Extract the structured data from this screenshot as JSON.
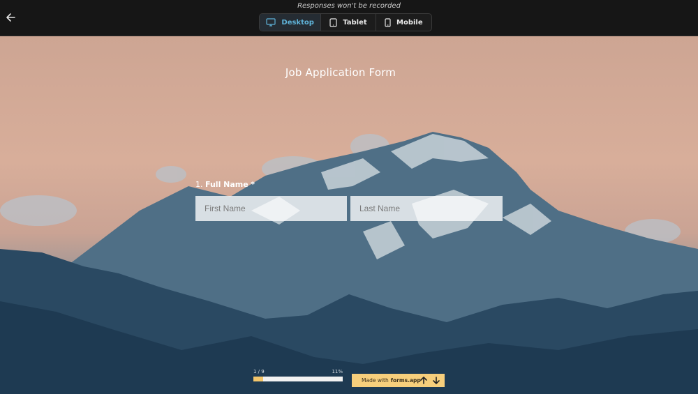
{
  "topbar": {
    "notice": "Responses won't be recorded",
    "devices": [
      {
        "label": "Desktop",
        "icon": "monitor-icon",
        "active": true
      },
      {
        "label": "Tablet",
        "icon": "tablet-icon",
        "active": false
      },
      {
        "label": "Mobile",
        "icon": "mobile-icon",
        "active": false
      }
    ]
  },
  "form": {
    "title": "Job Application Form",
    "question": {
      "number": "1.",
      "label": "Full Name",
      "required_mark": "*",
      "first_placeholder": "First Name",
      "last_placeholder": "Last Name"
    }
  },
  "footer": {
    "progress_text": "1 / 9",
    "progress_percent": "11%",
    "progress_value": 0.11,
    "made_with": "Made with",
    "brand": "forms.app"
  },
  "colors": {
    "accent": "#5fb3d9",
    "progress_fill": "#f4c66b",
    "brand_box": "#f7cf7c"
  }
}
